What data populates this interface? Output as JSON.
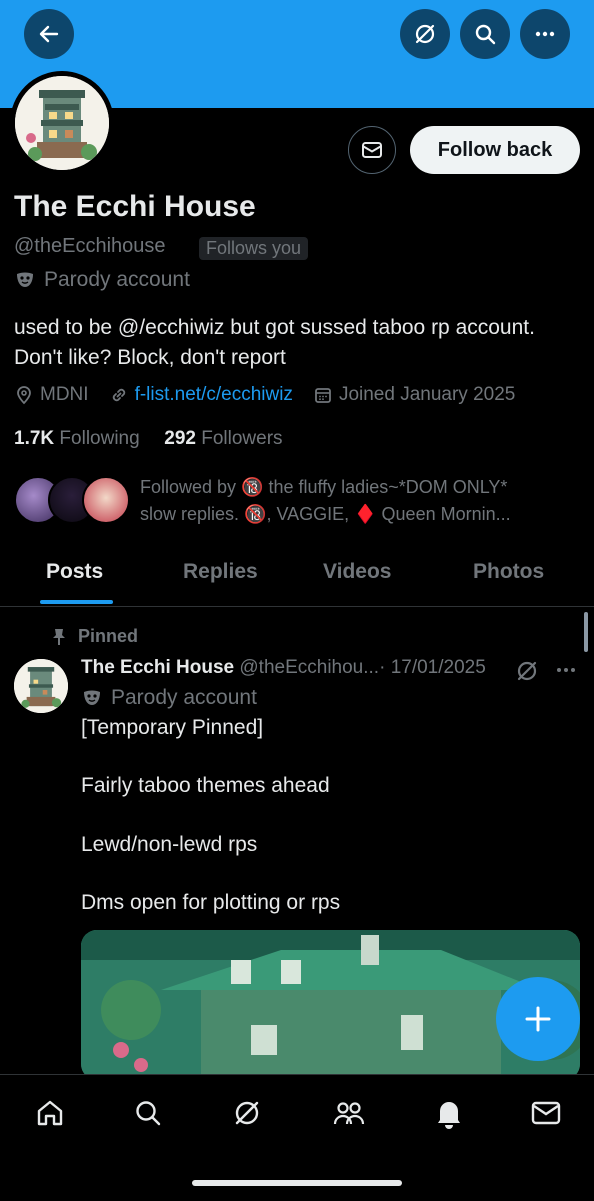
{
  "header": {
    "back_icon": "arrow-left-icon",
    "grok_icon": "grok-icon",
    "search_icon": "search-icon",
    "more_icon": "more-icon",
    "banner_color": "#1d9bf0"
  },
  "profile": {
    "name": "The Ecchi House",
    "handle": "@theEcchihouse",
    "follows_you": "Follows you",
    "parody_label": "Parody account",
    "bio": "used to be @/ecchiwiz but got sussed taboo rp account. Don't like? Block, don't report",
    "location": "MDNI",
    "link": "f-list.net/c/ecchiwiz",
    "joined": "Joined January 2025",
    "following_count": "1.7K",
    "following_label": "Following",
    "followers_count": "292",
    "followers_label": "Followers",
    "follow_button": "Follow back",
    "followed_by_line1": "Followed by 🔞 the fluffy ladies~*DOM ONLY*",
    "followed_by_line2": "slow replies. 🔞, VAGGIE, ♦️ Queen Mornin..."
  },
  "tabs": [
    "Posts",
    "Replies",
    "Videos",
    "Photos"
  ],
  "post": {
    "pinned_label": "Pinned",
    "author_name": "The Ecchi House",
    "author_handle": "@theEcchihou...",
    "date": "· 17/01/2025",
    "parody_label": "Parody account",
    "lines": [
      "[Temporary Pinned]",
      "Fairly taboo themes ahead",
      "Lewd/non-lewd rps",
      "Dms open for plotting or rps"
    ]
  },
  "nav": [
    "home-icon",
    "search-icon",
    "grok-icon",
    "communities-icon",
    "notifications-icon",
    "messages-icon"
  ],
  "colors": {
    "accent": "#1d9bf0",
    "muted": "#71767b",
    "text": "#e7e9ea"
  }
}
